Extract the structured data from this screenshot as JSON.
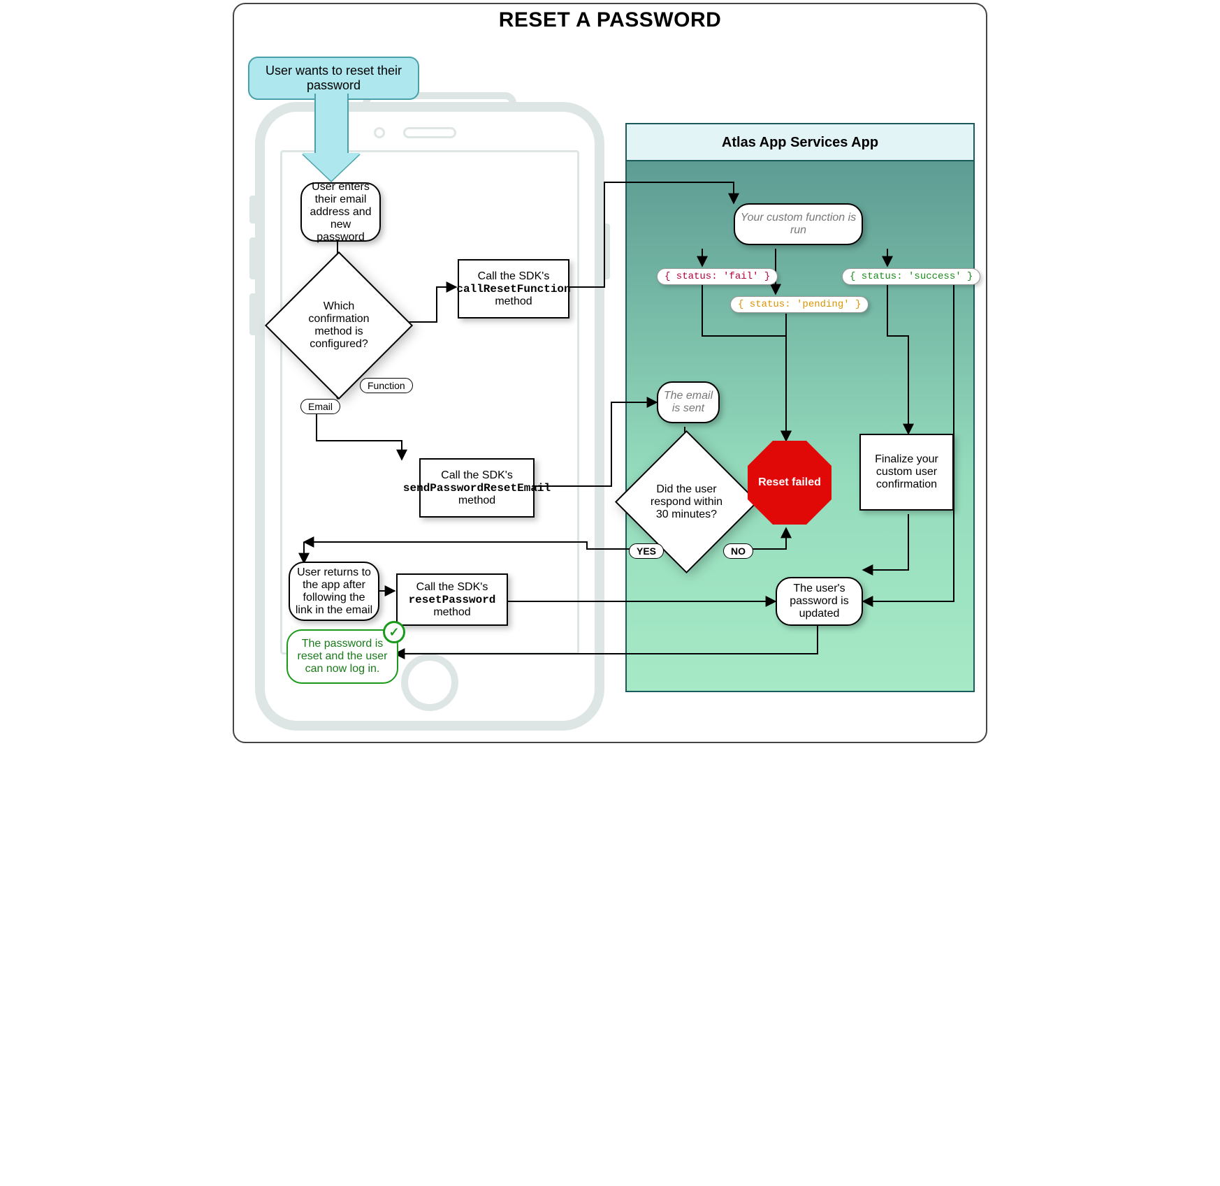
{
  "title": "RESET A PASSWORD",
  "callout": "User wants to reset their password",
  "server_title": "Atlas App Services App",
  "phone": {
    "enter": "User enters their email address and new password",
    "decide": "Which confirmation method is configured?",
    "label_function": "Function",
    "label_email": "Email",
    "call_func_pre": "Call the SDK's ",
    "call_func_code": "callResetFunction",
    "call_func_post": " method",
    "send_email_pre": "Call the SDK's ",
    "send_email_code": "sendPasswordResetEmail",
    "send_email_post": " method",
    "return": "User returns to the app after following the link in the email",
    "reset_pre": "Call the SDK's ",
    "reset_code": "resetPassword",
    "reset_post": " method",
    "result": "The password is reset and the user can now log in."
  },
  "server": {
    "custom_run": "Your custom function is run",
    "status_fail": "{ status: 'fail' }",
    "status_success": "{ status: 'success' }",
    "status_pending": "{ status: 'pending' }",
    "email_sent": "The email is sent",
    "respond30": "Did the user respond within 30 minutes?",
    "yes": "YES",
    "no": "NO",
    "reset_failed": "Reset failed",
    "finalize": "Finalize your custom user confirmation",
    "updated": "The user's password is updated"
  }
}
